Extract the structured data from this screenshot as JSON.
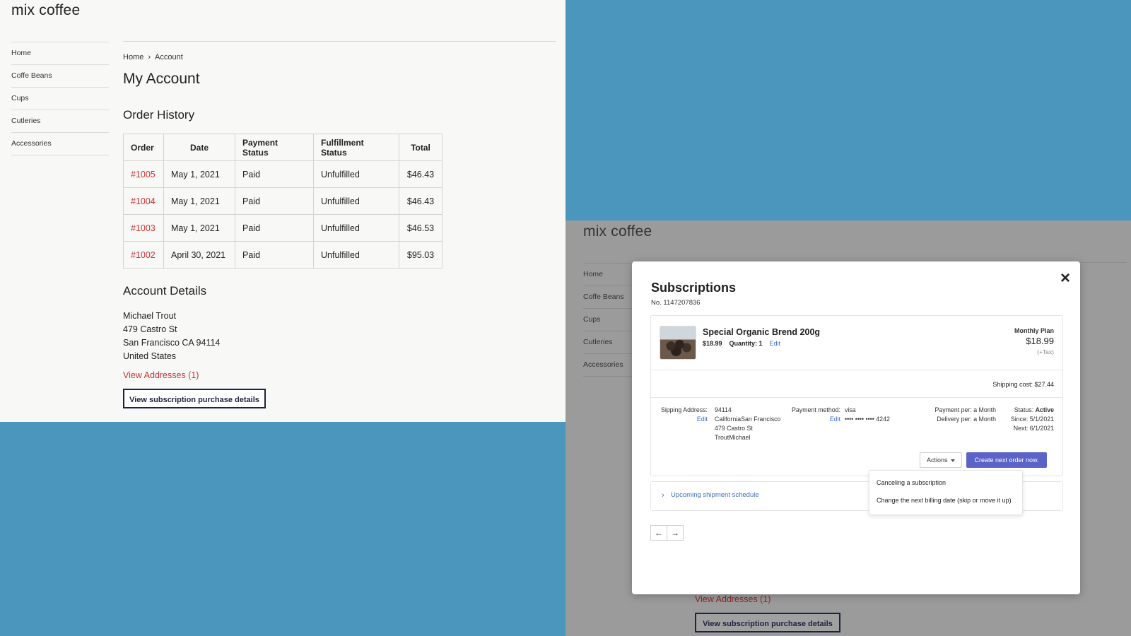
{
  "brand": "mix coffee",
  "nav": [
    "Home",
    "Coffe Beans",
    "Cups",
    "Cutleries",
    "Accessories"
  ],
  "breadcrumb": {
    "home": "Home",
    "separator": "›",
    "current": "Account"
  },
  "page_title": "My Account",
  "order_history": {
    "title": "Order History",
    "columns": [
      "Order",
      "Date",
      "Payment Status",
      "Fulfillment Status",
      "Total"
    ],
    "rows": [
      [
        "#1005",
        "May 1, 2021",
        "Paid",
        "Unfulfilled",
        "$46.43"
      ],
      [
        "#1004",
        "May 1, 2021",
        "Paid",
        "Unfulfilled",
        "$46.43"
      ],
      [
        "#1003",
        "May 1, 2021",
        "Paid",
        "Unfulfilled",
        "$46.53"
      ],
      [
        "#1002",
        "April 30, 2021",
        "Paid",
        "Unfulfilled",
        "$95.03"
      ]
    ]
  },
  "account_details": {
    "title": "Account Details",
    "lines": [
      "Michael Trout",
      "479 Castro St",
      "San Francisco CA 94114",
      "United States"
    ],
    "view_addresses": "View Addresses (1)",
    "subscription_button": "View subscription purchase details"
  },
  "modal": {
    "close_icon": "×",
    "title": "Subscriptions",
    "number": "No. 1147207836",
    "product": {
      "name": "Special Organic Brend 200g",
      "price": "$18.99",
      "quantity": "Quantity: 1",
      "edit": "Edit",
      "image_icon": "coffee-beans-thumbnail"
    },
    "plan": {
      "label": "Monthly Plan",
      "price": "$18.99",
      "tax": "(+Tax)"
    },
    "shipping_cost": "Shipping cost: $27.44",
    "shipping_address": {
      "label": "Sipping Address:",
      "edit": "Edit",
      "lines": [
        "94114",
        "CaliforniaSan Francisco",
        "479 Castro St",
        "TroutMichael"
      ]
    },
    "payment_method": {
      "label": "Payment method:",
      "edit": "Edit",
      "lines": [
        "visa",
        "•••• •••• •••• 4242"
      ]
    },
    "frequency": {
      "payment": "Payment per: a Month",
      "delivery": "Delivery per: a Month"
    },
    "status": {
      "label": "Status:",
      "value": "Active",
      "since": "Since: 5/1/2021",
      "next": "Next: 6/1/2021"
    },
    "actions_label": "Actions",
    "create_button": "Create next order now.",
    "actions_menu": [
      "Canceling a subscription",
      "Change the next billing date (skip or move it up)"
    ],
    "upcoming": "Upcoming shipment schedule",
    "pager": {
      "prev": "←",
      "next": "→"
    }
  },
  "colors": {
    "background": "#4a96bd",
    "page": "#f8f8f7",
    "dimmed_page": "#9b9b9b",
    "link_red": "#cc3333",
    "primary_button": "#5b63c6",
    "edit_link": "#3b6fc4"
  }
}
